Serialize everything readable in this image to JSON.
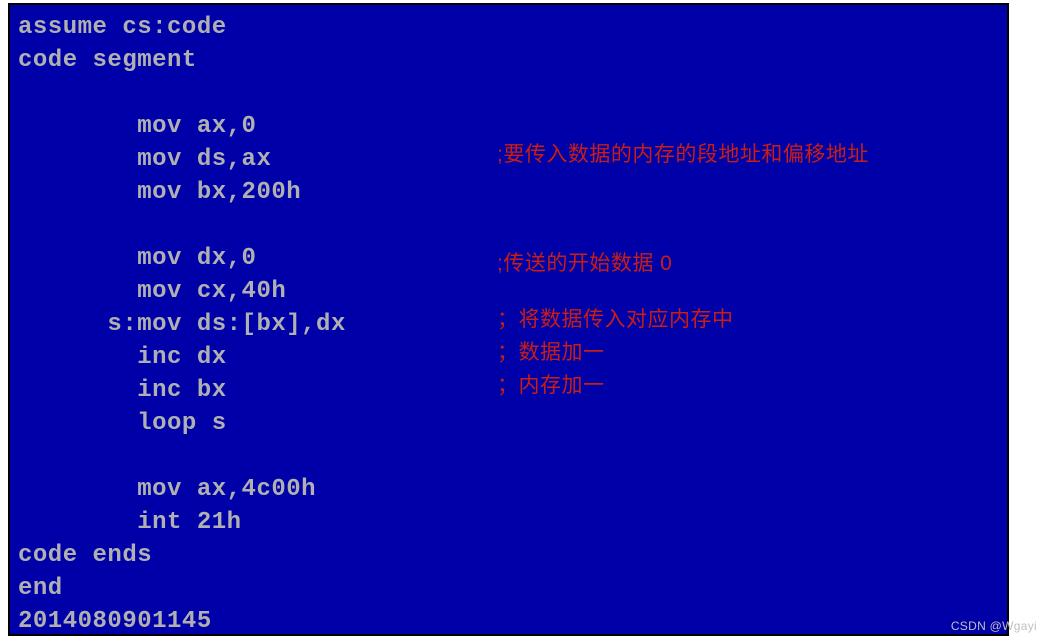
{
  "code": {
    "l01": "assume cs:code",
    "l02": "code segment",
    "l03": "",
    "l04": "        mov ax,0",
    "l05": "        mov ds,ax",
    "l06": "        mov bx,200h",
    "l07": "",
    "l08": "        mov dx,0",
    "l09": "        mov cx,40h",
    "l10": "      s:mov ds:[bx],dx",
    "l11": "        inc dx",
    "l12": "        inc bx",
    "l13": "        loop s",
    "l14": "",
    "l15": "        mov ax,4c00h",
    "l16": "        int 21h",
    "l17": "code ends",
    "l18": "end",
    "l19": "2014080901145"
  },
  "comments": {
    "c1": ";要传入数据的内存的段地址和偏移地址",
    "c2": ";传送的开始数据 0",
    "c3a": "；将数据传入对应内存中",
    "c3b": "；数据加一",
    "c3c": "；内存加一"
  },
  "watermark": "CSDN @Wgayi"
}
